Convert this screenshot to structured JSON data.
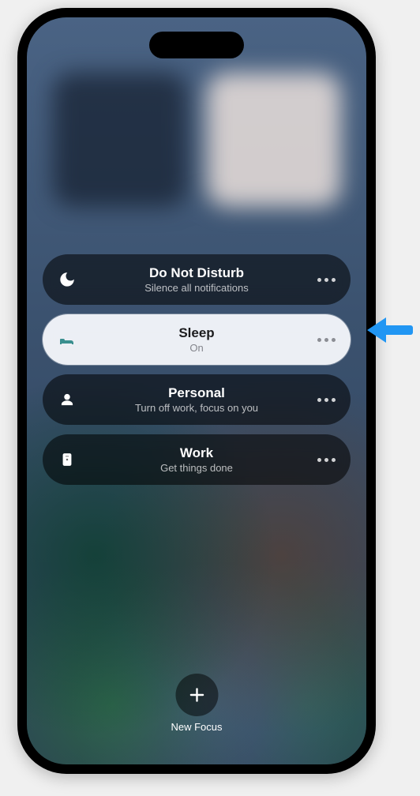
{
  "focus_modes": [
    {
      "id": "dnd",
      "title": "Do Not Disturb",
      "subtitle": "Silence all notifications",
      "icon": "moon-icon",
      "active": false
    },
    {
      "id": "sleep",
      "title": "Sleep",
      "subtitle": "On",
      "icon": "bed-icon",
      "active": true
    },
    {
      "id": "personal",
      "title": "Personal",
      "subtitle": "Turn off work, focus on you",
      "icon": "person-icon",
      "active": false
    },
    {
      "id": "work",
      "title": "Work",
      "subtitle": "Get things done",
      "icon": "badge-icon",
      "active": false
    }
  ],
  "new_focus": {
    "label": "New Focus"
  },
  "callout": {
    "points_to": "sleep",
    "color": "#2196f3"
  }
}
